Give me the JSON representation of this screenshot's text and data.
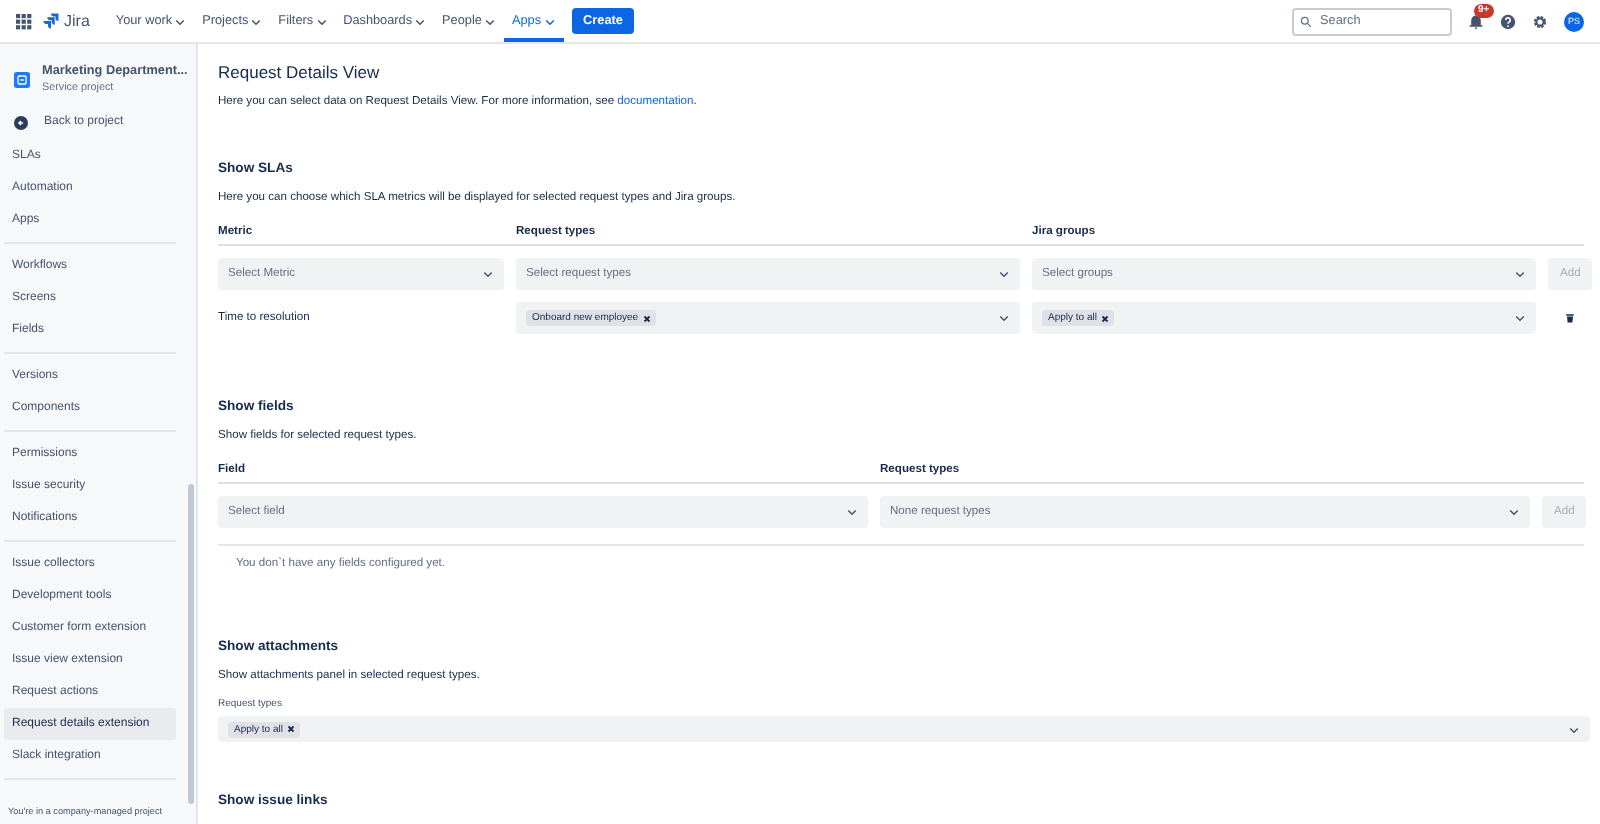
{
  "nav": {
    "logo": "Jira",
    "items": [
      {
        "label": "Your work",
        "selected": false
      },
      {
        "label": "Projects",
        "selected": false
      },
      {
        "label": "Filters",
        "selected": false
      },
      {
        "label": "Dashboards",
        "selected": false
      },
      {
        "label": "People",
        "selected": false
      },
      {
        "label": "Apps",
        "selected": true
      }
    ],
    "create": "Create",
    "search": {
      "placeholder": "Search"
    },
    "badge": "9+",
    "avatar": "PS"
  },
  "project": {
    "name": "Marketing Department...",
    "type": "Service project",
    "back": "Back to project"
  },
  "sidebar": {
    "groups": [
      [
        {
          "label": "SLAs",
          "selected": false
        },
        {
          "label": "Automation",
          "selected": false
        },
        {
          "label": "Apps",
          "selected": false
        }
      ],
      [
        {
          "label": "Workflows",
          "selected": false
        },
        {
          "label": "Screens",
          "selected": false
        },
        {
          "label": "Fields",
          "selected": false
        }
      ],
      [
        {
          "label": "Versions",
          "selected": false
        },
        {
          "label": "Components",
          "selected": false
        }
      ],
      [
        {
          "label": "Permissions",
          "selected": false
        },
        {
          "label": "Issue security",
          "selected": false
        },
        {
          "label": "Notifications",
          "selected": false
        }
      ],
      [
        {
          "label": "Issue collectors",
          "selected": false
        },
        {
          "label": "Development tools",
          "selected": false
        },
        {
          "label": "Customer form extension",
          "selected": false
        },
        {
          "label": "Issue view extension",
          "selected": false
        },
        {
          "label": "Request actions",
          "selected": false
        },
        {
          "label": "Request details extension",
          "selected": true
        },
        {
          "label": "Slack integration",
          "selected": false
        }
      ]
    ],
    "footer": "You're in a company-managed project"
  },
  "page": {
    "title": "Request Details View",
    "intro": "Here you can select data on Request Details View. For more information, see",
    "intro_link": "documentation",
    "intro_end": "."
  },
  "slas": {
    "title": "Show SLAs",
    "description": "Here you can choose which SLA metrics will be displayed for selected request types and Jira groups.",
    "columns": [
      "Metric",
      "Request types",
      "Jira groups"
    ],
    "new_row": {
      "metric": "Select Metric",
      "request_types": "Select request types",
      "groups": "Select groups",
      "add": "Add"
    },
    "rows": [
      {
        "metric": "Time to resolution",
        "request_types": [
          "Onboard new employee"
        ],
        "groups": [
          "Apply to all"
        ]
      }
    ]
  },
  "fields": {
    "title": "Show fields",
    "description": "Show fields for selected request types.",
    "columns": [
      "Field",
      "Request types"
    ],
    "new_row": {
      "field": "Select field",
      "request_types": "None request types",
      "add": "Add"
    },
    "empty": "You don`t have any fields configured yet."
  },
  "attachments": {
    "title": "Show attachments",
    "description": "Show attachments panel in selected request types.",
    "label": "Request types",
    "values": [
      "Apply to all"
    ]
  },
  "links": {
    "title": "Show issue links"
  }
}
